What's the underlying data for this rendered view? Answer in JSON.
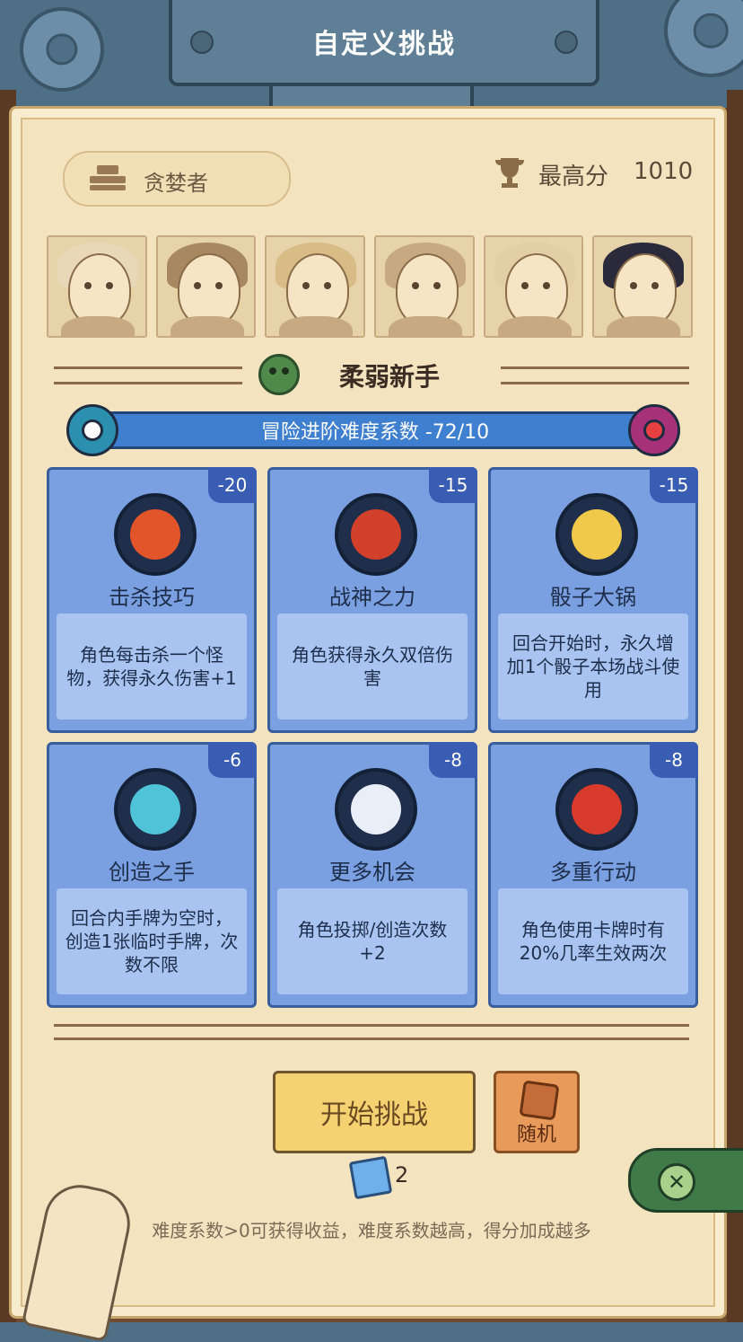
{
  "header": {
    "title": "自定义挑战"
  },
  "info": {
    "player_name": "贪婪者",
    "best_score_label": "最高分",
    "best_score_value": "1010"
  },
  "portraits": [
    {
      "name": "fur-hood-character",
      "hair_color": "#e8d8b8"
    },
    {
      "name": "cowboy-character",
      "hair_color": "#a88860"
    },
    {
      "name": "braided-character",
      "hair_color": "#d9bb86"
    },
    {
      "name": "mushroom-character",
      "hair_color": "#c7a982"
    },
    {
      "name": "ponytail-character",
      "hair_color": "#e3cfa5"
    },
    {
      "name": "witch-character",
      "hair_color": "#2b2a3a"
    }
  ],
  "difficulty": {
    "title": "柔弱新手",
    "progress_text": "冒险进阶难度系数  -72/10"
  },
  "cards": [
    {
      "name": "击杀技巧",
      "value": "-20",
      "desc": "角色每击杀一个怪物，获得永久伤害+1",
      "core_color": "#e2542a"
    },
    {
      "name": "战神之力",
      "value": "-15",
      "desc": "角色获得永久双倍伤害",
      "core_color": "#d2402c"
    },
    {
      "name": "骰子大锅",
      "value": "-15",
      "desc": "回合开始时，永久增加1个骰子本场战斗使用",
      "core_color": "#f0c84a"
    },
    {
      "name": "创造之手",
      "value": "-6",
      "desc": "回合内手牌为空时，创造1张临时手牌，次数不限",
      "core_color": "#4fc4d9"
    },
    {
      "name": "更多机会",
      "value": "-8",
      "desc": "角色投掷/创造次数+2",
      "core_color": "#e9eef8"
    },
    {
      "name": "多重行动",
      "value": "-8",
      "desc": "角色使用卡牌时有20%几率生效两次",
      "core_color": "#d83a2c"
    }
  ],
  "actions": {
    "start_label": "开始挑战",
    "random_label": "随机",
    "ticket_count": "2"
  },
  "footnote": "难度系数>0可获得收益，难度系数越高，得分加成越多",
  "colors": {
    "card_bg": "#7aa0e2",
    "progress": "#3f7fcf",
    "start_button": "#f5d271",
    "random_button": "#e89a5a"
  }
}
